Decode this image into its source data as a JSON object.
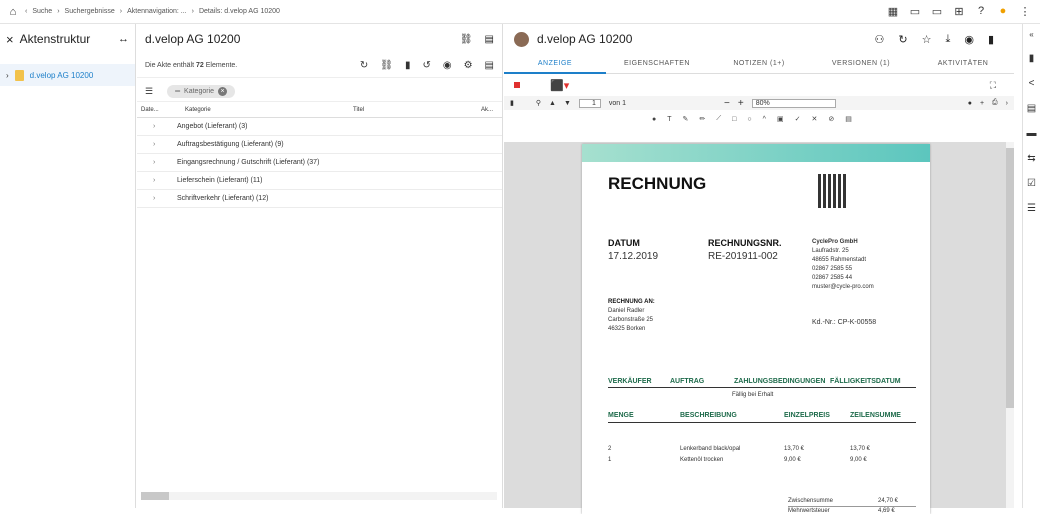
{
  "breadcrumb": [
    "Suche",
    "Suchergebnisse",
    "Aktennavigation: ...",
    "Details: d.velop AG 10200"
  ],
  "left_panel": {
    "title": "Aktenstruktur",
    "tree_item": "d.velop AG 10200"
  },
  "middle_panel": {
    "title": "d.velop AG 10200",
    "count_prefix": "Die Akte enthält",
    "count": "72",
    "count_suffix": "Elemente.",
    "filter_chip": "Kategorie",
    "columns": [
      "Date...",
      "Kategorie",
      "Titel",
      "Ak..."
    ],
    "rows": [
      "Angebot (Lieferant) (3)",
      "Auftragsbestätigung (Lieferant) (9)",
      "Eingangsrechnung / Gutschrift (Lieferant) (37)",
      "Lieferschein (Lieferant) (11)",
      "Schriftverkehr (Lieferant) (12)"
    ]
  },
  "right_panel": {
    "title": "d.velop AG 10200",
    "tabs": [
      "ANZEIGE",
      "EIGENSCHAFTEN",
      "NOTIZEN (1+)",
      "VERSIONEN (1)",
      "AKTIVITÄTEN"
    ],
    "page_input": "1",
    "page_of": "von 1",
    "zoom": "80%"
  },
  "invoice": {
    "title": "RECHNUNG",
    "datum_label": "DATUM",
    "datum": "17.12.2019",
    "nr_label": "RECHNUNGSNR.",
    "nr": "RE-201911-002",
    "company": "CyclePro GmbH",
    "company_lines": [
      "Laufradstr. 25",
      "48655 Rahmenstadt",
      "02867 2585 55",
      "02867 2585 44",
      "muster@cycle-pro.com"
    ],
    "to_label": "RECHNUNG AN:",
    "to_lines": [
      "Daniel Radler",
      "Carbonstraße 25",
      "46325 Borken"
    ],
    "kd_nr": "Kd.-Nr.: CP-K-00558",
    "head1": [
      "VERKÄUFER",
      "AUFTRAG",
      "ZAHLUNGSBEDINGUNGEN",
      "FÄLLIGKEITSDATUM"
    ],
    "payment": "Fällig bei Erhalt",
    "head2": [
      "MENGE",
      "BESCHREIBUNG",
      "EINZELPREIS",
      "ZEILENSUMME"
    ],
    "items": [
      {
        "qty": "2",
        "desc": "Lenkerband black/opal",
        "price": "13,70 €",
        "sum": "13,70 €"
      },
      {
        "qty": "1",
        "desc": "Kettenöl trocken",
        "price": "9,00 €",
        "sum": "9,00 €"
      }
    ],
    "subtotal_label": "Zwischensumme",
    "subtotal": "24,70 €",
    "tax_label": "Mehrwertsteuer",
    "tax": "4,69 €"
  }
}
